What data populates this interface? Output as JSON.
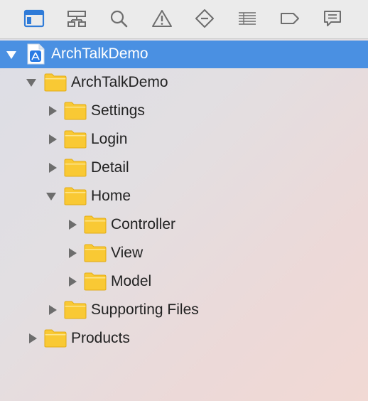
{
  "toolbar": {
    "icons": [
      {
        "name": "project-navigator-icon",
        "selected": true
      },
      {
        "name": "symbol-navigator-icon"
      },
      {
        "name": "find-navigator-icon"
      },
      {
        "name": "issue-navigator-icon"
      },
      {
        "name": "test-navigator-icon"
      },
      {
        "name": "debug-navigator-icon"
      },
      {
        "name": "breakpoint-navigator-icon"
      },
      {
        "name": "report-navigator-icon"
      }
    ],
    "accent": "#2f7bd8",
    "icon_color": "#6e6e6e"
  },
  "tree": {
    "selection_color": "#4a90e2",
    "folder_color": "#f9c934",
    "project": {
      "label": "ArchTalkDemo",
      "expanded": true
    },
    "group_root": {
      "label": "ArchTalkDemo",
      "expanded": true
    },
    "settings": {
      "label": "Settings",
      "expanded": false
    },
    "login": {
      "label": "Login",
      "expanded": false
    },
    "detail": {
      "label": "Detail",
      "expanded": false
    },
    "home": {
      "label": "Home",
      "expanded": true
    },
    "controller": {
      "label": "Controller",
      "expanded": false
    },
    "view": {
      "label": "View",
      "expanded": false
    },
    "model": {
      "label": "Model",
      "expanded": false
    },
    "supporting": {
      "label": "Supporting Files",
      "expanded": false
    },
    "products": {
      "label": "Products",
      "expanded": false
    }
  }
}
